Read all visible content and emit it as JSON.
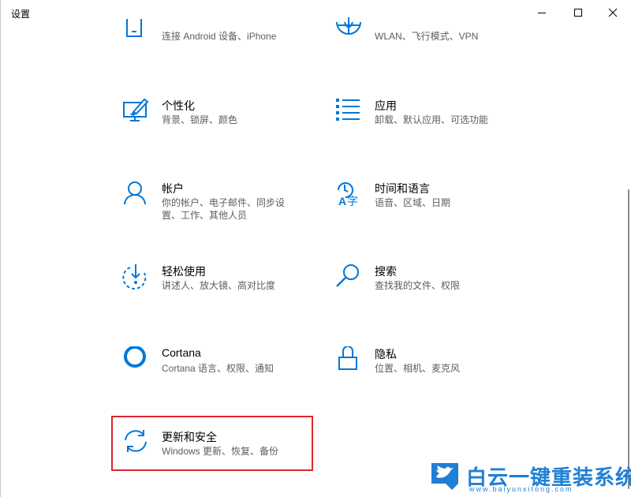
{
  "window": {
    "title": "设置"
  },
  "tiles": [
    {
      "id": "phone",
      "title": "",
      "desc1": "连接 Android 设备、iPhone",
      "desc2": "",
      "icon": "phone-icon"
    },
    {
      "id": "network",
      "title": "",
      "desc1": "WLAN、飞行模式、VPN",
      "desc2": "",
      "icon": "globe-icon"
    },
    {
      "id": "personalization",
      "title": "个性化",
      "desc1": "背景、锁屏、颜色",
      "desc2": "",
      "icon": "personalization-icon"
    },
    {
      "id": "apps",
      "title": "应用",
      "desc1": "卸载、默认应用、可选功能",
      "desc2": "",
      "icon": "apps-list-icon"
    },
    {
      "id": "accounts",
      "title": "帐户",
      "desc1": "你的帐户、电子邮件、同步设",
      "desc2": "置、工作、其他人员",
      "icon": "person-icon"
    },
    {
      "id": "time-language",
      "title": "时间和语言",
      "desc1": "语音、区域、日期",
      "desc2": "",
      "icon": "time-language-icon"
    },
    {
      "id": "ease-of-access",
      "title": "轻松使用",
      "desc1": "讲述人、放大镜、高对比度",
      "desc2": "",
      "icon": "ease-of-access-icon"
    },
    {
      "id": "search",
      "title": "搜索",
      "desc1": "查找我的文件、权限",
      "desc2": "",
      "icon": "search-icon"
    },
    {
      "id": "cortana",
      "title": "Cortana",
      "desc1": "Cortana 语言、权限、通知",
      "desc2": "",
      "icon": "cortana-ring-icon"
    },
    {
      "id": "privacy",
      "title": "隐私",
      "desc1": "位置、相机、麦克风",
      "desc2": "",
      "icon": "lock-icon"
    },
    {
      "id": "update-security",
      "title": "更新和安全",
      "desc1": "Windows 更新、恢复、备份",
      "desc2": "",
      "icon": "sync-arrows-icon"
    }
  ],
  "watermark": {
    "text": "白云一键重装系统",
    "url": "www.baiyunxitong.com"
  },
  "colors": {
    "accent": "#0078d7",
    "highlight": "#e0262d",
    "watermark": "#1f7fd6"
  }
}
